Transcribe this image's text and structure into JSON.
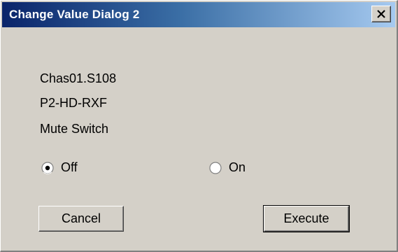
{
  "window": {
    "title": "Change Value Dialog 2",
    "close_label": "X"
  },
  "info": {
    "chassis": "Chas01.S108",
    "module": "P2-HD-RXF",
    "parameter": "Mute Switch"
  },
  "options": {
    "off_label": "Off",
    "on_label": "On",
    "selected": "Off"
  },
  "buttons": {
    "cancel_label": "Cancel",
    "execute_label": "Execute"
  },
  "icons": {
    "close": "close-icon",
    "radio_selected": "radio-selected-icon",
    "radio_unselected": "radio-unselected-icon"
  }
}
